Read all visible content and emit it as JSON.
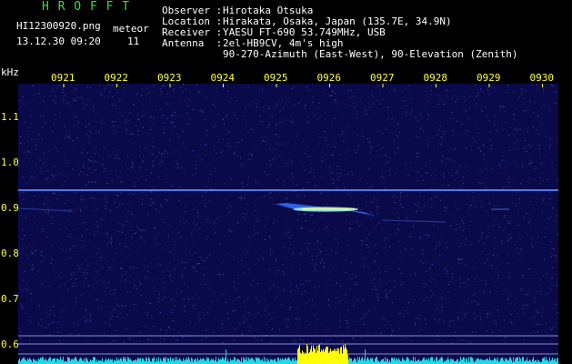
{
  "app": {
    "title": "H R O F F T"
  },
  "file": {
    "name": "HI12300920.png",
    "datetime": "13.12.30 09:20"
  },
  "counter": {
    "label": "meteor",
    "value": "11"
  },
  "info": {
    "observer_label": "Observer :",
    "observer_value": "Hirotaka Otsuka",
    "location_label": "Location :",
    "location_value": "Hirakata, Osaka, Japan (135.7E, 34.9N)",
    "receiver_label": "Receiver :",
    "receiver_value": "YAESU FT-690 53.749MHz, USB",
    "antenna_label": "Antenna  :",
    "antenna_value": "2el-HB9CV, 4m's high",
    "antenna_value2": "90-270-Azimuth (East-West), 90-Elevation (Zenith)"
  },
  "axis": {
    "unit": "kHz",
    "time_ticks": [
      "0921",
      "0922",
      "0923",
      "0924",
      "0925",
      "0926",
      "0927",
      "0928",
      "0929",
      "0930"
    ],
    "freq_ticks": [
      "1.1",
      "1.0",
      "0.9",
      "0.8",
      "0.7",
      "0.6"
    ]
  },
  "colors": {
    "background": "#000000",
    "plot_bg": "#0a0a4a",
    "title_green": "#3cdc3c",
    "label_yellow": "#ffff3c",
    "carrier": "#4a7aff",
    "meteor": "#9ff0ff",
    "signal_cyan": "#27d6e6",
    "signal_yellow": "#ffff00"
  }
}
